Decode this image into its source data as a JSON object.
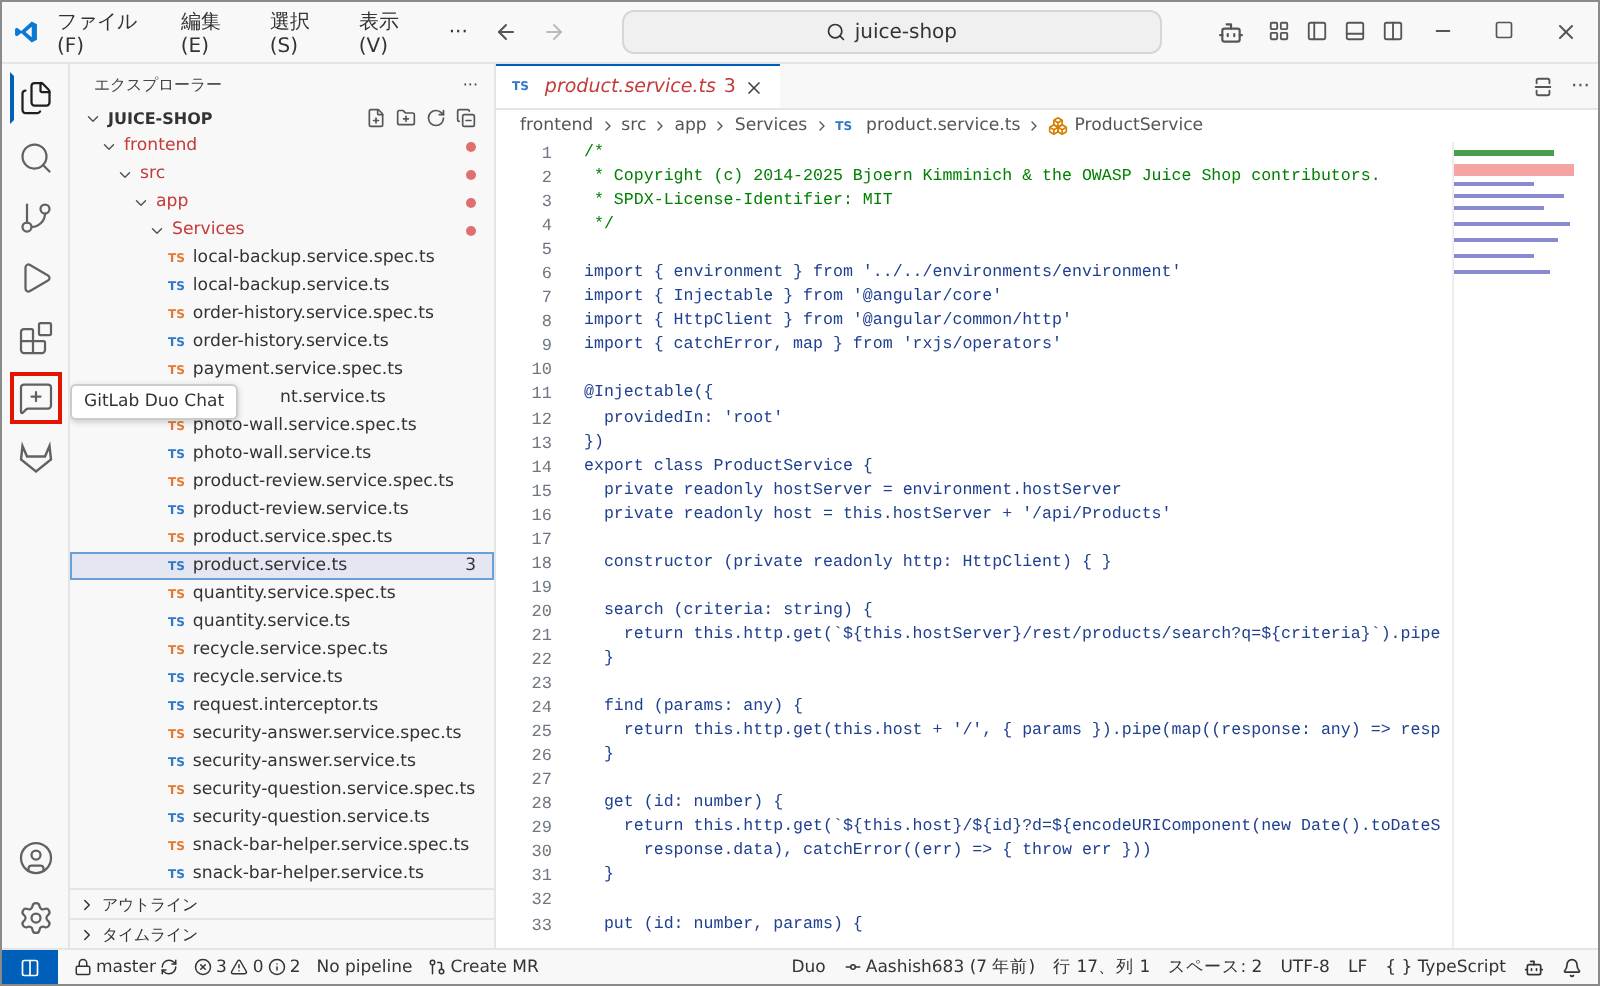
{
  "titlebar": {
    "menus": [
      "ファイル(F)",
      "編集(E)",
      "選択(S)",
      "表示(V)",
      "···"
    ],
    "search": "juice-shop"
  },
  "activity": [
    {
      "kind": "files",
      "selected": true
    },
    {
      "kind": "search",
      "selected": false
    },
    {
      "kind": "git",
      "selected": false
    },
    {
      "kind": "debug",
      "selected": false
    },
    {
      "kind": "extensions",
      "selected": false
    },
    {
      "kind": "chat",
      "selected": false,
      "highlighted": true
    },
    {
      "kind": "fox",
      "selected": false
    }
  ],
  "activity_bottom": [
    {
      "kind": "account"
    },
    {
      "kind": "settings"
    }
  ],
  "tooltip": "GitLab Duo Chat",
  "sidebar": {
    "title": "エクスプローラー",
    "more": "···",
    "tree": [
      {
        "label": "JUICE-SHOP",
        "kind": "root",
        "expanded": true,
        "children": [
          {
            "label": "frontend",
            "kind": "folder",
            "expanded": true,
            "modified": true,
            "children": [
              {
                "label": "src",
                "kind": "folder",
                "expanded": true,
                "modified": true,
                "children": [
                  {
                    "label": "app",
                    "kind": "folder",
                    "expanded": true,
                    "modified": true,
                    "children": [
                      {
                        "label": "Services",
                        "kind": "folder",
                        "expanded": true,
                        "modified": true,
                        "children": [
                          {
                            "icon": "TS",
                            "label": "local-backup.service.spec.ts",
                            "kind": "spec",
                            "selected": false
                          },
                          {
                            "icon": "TS",
                            "label": "local-backup.service.ts",
                            "kind": "source",
                            "selected": false
                          },
                          {
                            "icon": "TS",
                            "label": "order-history.service.spec.ts",
                            "kind": "spec",
                            "selected": false
                          },
                          {
                            "icon": "TS",
                            "label": "order-history.service.ts",
                            "kind": "source",
                            "selected": false
                          },
                          {
                            "icon": "TS",
                            "label": "payment.service.spec.ts",
                            "kind": "spec",
                            "selected": false
                          },
                          {
                            "label": "nt.service.ts",
                            "kind": "source",
                            "selected": false,
                            "covered": true
                          },
                          {
                            "icon": "TS",
                            "label": "photo-wall.service.spec.ts",
                            "kind": "spec",
                            "selected": false
                          },
                          {
                            "icon": "TS",
                            "label": "photo-wall.service.ts",
                            "kind": "source",
                            "selected": false
                          },
                          {
                            "icon": "TS",
                            "label": "product-review.service.spec.ts",
                            "kind": "spec",
                            "selected": false
                          },
                          {
                            "icon": "TS",
                            "label": "product-review.service.ts",
                            "kind": "source",
                            "selected": false
                          },
                          {
                            "icon": "TS",
                            "label": "product.service.spec.ts",
                            "kind": "spec",
                            "selected": false
                          },
                          {
                            "icon": "TS",
                            "label": "product.service.ts",
                            "kind": "source",
                            "selected": true,
                            "badge": "3"
                          },
                          {
                            "icon": "TS",
                            "label": "quantity.service.spec.ts",
                            "kind": "spec",
                            "selected": false
                          },
                          {
                            "icon": "TS",
                            "label": "quantity.service.ts",
                            "kind": "source",
                            "selected": false
                          },
                          {
                            "icon": "TS",
                            "label": "recycle.service.spec.ts",
                            "kind": "spec",
                            "selected": false
                          },
                          {
                            "icon": "TS",
                            "label": "recycle.service.ts",
                            "kind": "source",
                            "selected": false
                          },
                          {
                            "icon": "TS",
                            "label": "request.interceptor.ts",
                            "kind": "source",
                            "selected": false
                          },
                          {
                            "icon": "TS",
                            "label": "security-answer.service.spec.ts",
                            "kind": "spec",
                            "selected": false
                          },
                          {
                            "icon": "TS",
                            "label": "security-answer.service.ts",
                            "kind": "source",
                            "selected": false
                          },
                          {
                            "icon": "TS",
                            "label": "security-question.service.spec.ts",
                            "kind": "spec",
                            "selected": false
                          },
                          {
                            "icon": "TS",
                            "label": "security-question.service.ts",
                            "kind": "source",
                            "selected": false
                          },
                          {
                            "icon": "TS",
                            "label": "snack-bar-helper.service.spec.ts",
                            "kind": "spec",
                            "selected": false
                          },
                          {
                            "icon": "TS",
                            "label": "snack-bar-helper.service.ts",
                            "kind": "source",
                            "selected": false
                          }
                        ]
                      }
                    ]
                  }
                ]
              }
            ]
          }
        ]
      }
    ],
    "panels": [
      {
        "label": "アウトライン",
        "expanded": false
      },
      {
        "label": "タイムライン",
        "expanded": false
      }
    ]
  },
  "tab": {
    "icon": "TS",
    "label": "product.service.ts",
    "count": "3"
  },
  "breadcrumb": [
    "frontend",
    "src",
    "app",
    "Services",
    "product.service.ts",
    "ProductService"
  ],
  "breadcrumb_file_icon": "TS",
  "lines": [
    {
      "n": "1",
      "kind": "comment",
      "text": "/*"
    },
    {
      "n": "2",
      "kind": "comment",
      "text": " * Copyright (c) 2014-2025 Bjoern Kimminich & the OWASP Juice Shop contributors."
    },
    {
      "n": "3",
      "kind": "comment",
      "text": " * SPDX-License-Identifier: MIT"
    },
    {
      "n": "4",
      "kind": "comment",
      "text": " */"
    },
    {
      "n": "5"
    },
    {
      "n": "6",
      "kind": "code",
      "text": "import { environment } from '../../environments/environment'"
    },
    {
      "n": "7",
      "kind": "code",
      "text": "import { Injectable } from '@angular/core'"
    },
    {
      "n": "8",
      "kind": "code",
      "text": "import { HttpClient } from '@angular/common/http'"
    },
    {
      "n": "9",
      "kind": "code",
      "text": "import { catchError, map } from 'rxjs/operators'"
    },
    {
      "n": "10"
    },
    {
      "n": "11",
      "kind": "code",
      "text": "@Injectable({"
    },
    {
      "n": "12",
      "kind": "code",
      "text": "  providedIn: 'root'"
    },
    {
      "n": "13",
      "kind": "code",
      "text": "})"
    },
    {
      "n": "14",
      "kind": "code",
      "text": "export class ProductService {"
    },
    {
      "n": "15",
      "kind": "code",
      "text": "  private readonly hostServer = environment.hostServer"
    },
    {
      "n": "16",
      "kind": "code",
      "text": "  private readonly host = this.hostServer + '/api/Products'"
    },
    {
      "n": "17"
    },
    {
      "n": "18",
      "kind": "code",
      "text": "  constructor (private readonly http: HttpClient) { }"
    },
    {
      "n": "19"
    },
    {
      "n": "20",
      "kind": "code",
      "text": "  search (criteria: string) {"
    },
    {
      "n": "21",
      "kind": "code",
      "text": "    return this.http.get(`${this.hostServer}/rest/products/search?q=${criteria}`).pipe"
    },
    {
      "n": "22",
      "kind": "code",
      "text": "  }"
    },
    {
      "n": "23"
    },
    {
      "n": "24",
      "kind": "code",
      "text": "  find (params: any) {"
    },
    {
      "n": "25",
      "kind": "code",
      "text": "    return this.http.get(this.host + '/', { params }).pipe(map((response: any) => resp"
    },
    {
      "n": "26",
      "kind": "code",
      "text": "  }"
    },
    {
      "n": "27"
    },
    {
      "n": "28",
      "kind": "code",
      "text": "  get (id: number) {"
    },
    {
      "n": "29",
      "kind": "code",
      "text": "    return this.http.get(`${this.host}/${id}?d=${encodeURIComponent(new Date().toDateS"
    },
    {
      "n": "30",
      "kind": "code",
      "text": "      response.data), catchError((err) => { throw err }))"
    },
    {
      "n": "31",
      "kind": "code",
      "text": "  }"
    },
    {
      "n": "32"
    },
    {
      "n": "33",
      "kind": "code",
      "text": "  put (id: number, params) {"
    }
  ],
  "status": {
    "branch": "master",
    "errors": "3",
    "warnings": "0",
    "infos": "2",
    "pipeline": "No pipeline",
    "mr": "Create MR",
    "right": [
      "Duo",
      "Aashish683 (7 年前)",
      "行 17、列 1",
      "スペース: 2",
      "UTF-8",
      "LF",
      "{ } TypeScript"
    ]
  }
}
